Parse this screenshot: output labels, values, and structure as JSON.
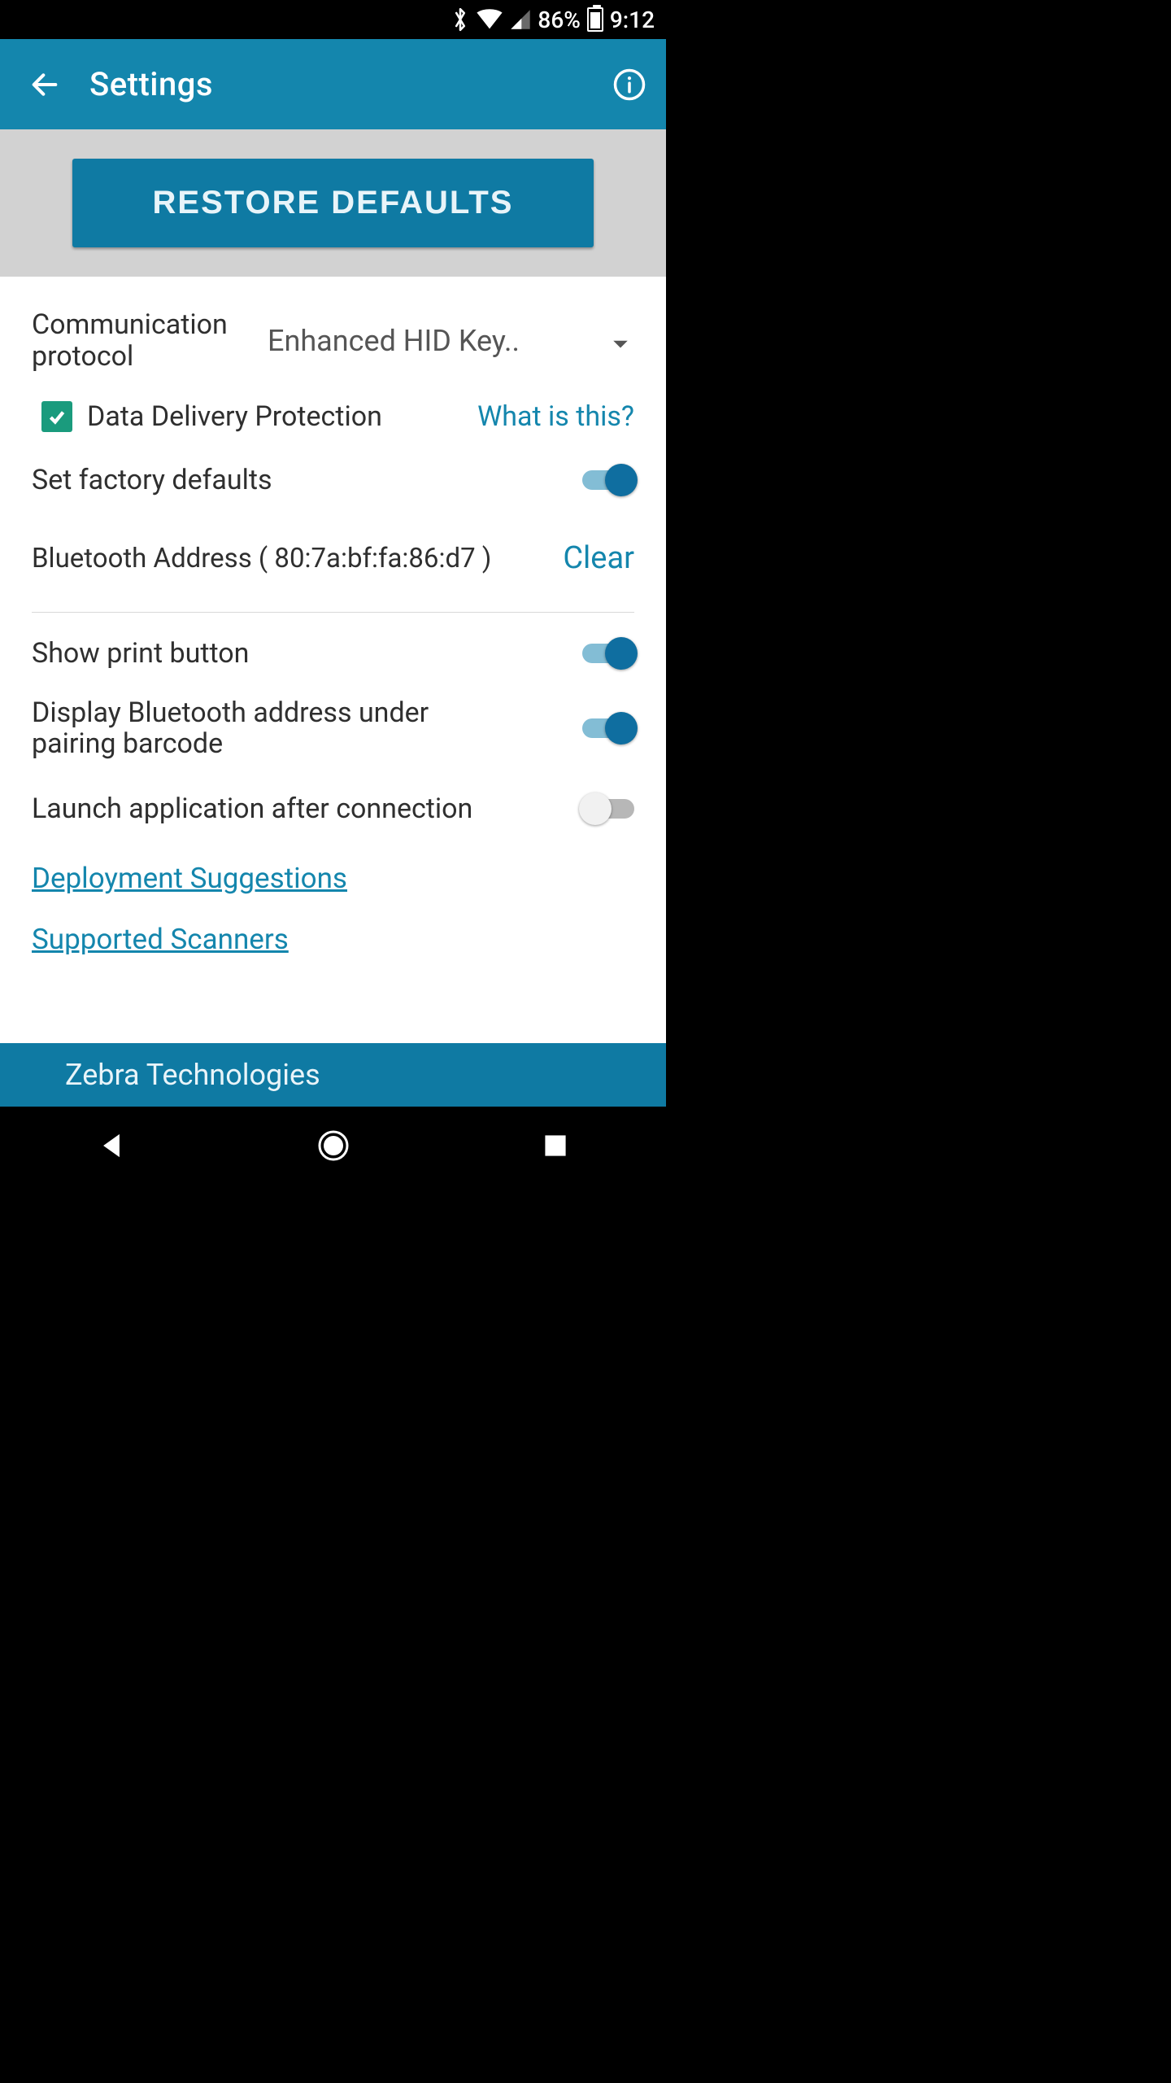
{
  "status": {
    "battery_percent": "86%",
    "time": "9:12"
  },
  "appbar": {
    "title": "Settings"
  },
  "restore": {
    "button_label": "RESTORE DEFAULTS"
  },
  "settings": {
    "protocol_label": "Communication protocol",
    "protocol_value": "Enhanced HID Key..",
    "ddp_label": "Data Delivery Protection",
    "ddp_help": "What is this?",
    "factory_defaults_label": "Set factory defaults",
    "bt_address_label": "Bluetooth Address ( 80:7a:bf:fa:86:d7 )",
    "bt_clear": "Clear",
    "show_print_label": "Show print button",
    "display_bt_label": "Display Bluetooth address under pairing barcode",
    "launch_app_label": "Launch application after connection",
    "deployment_link": "Deployment Suggestions",
    "scanners_link": "Supported Scanners"
  },
  "footer": {
    "brand": "Zebra Technologies"
  }
}
